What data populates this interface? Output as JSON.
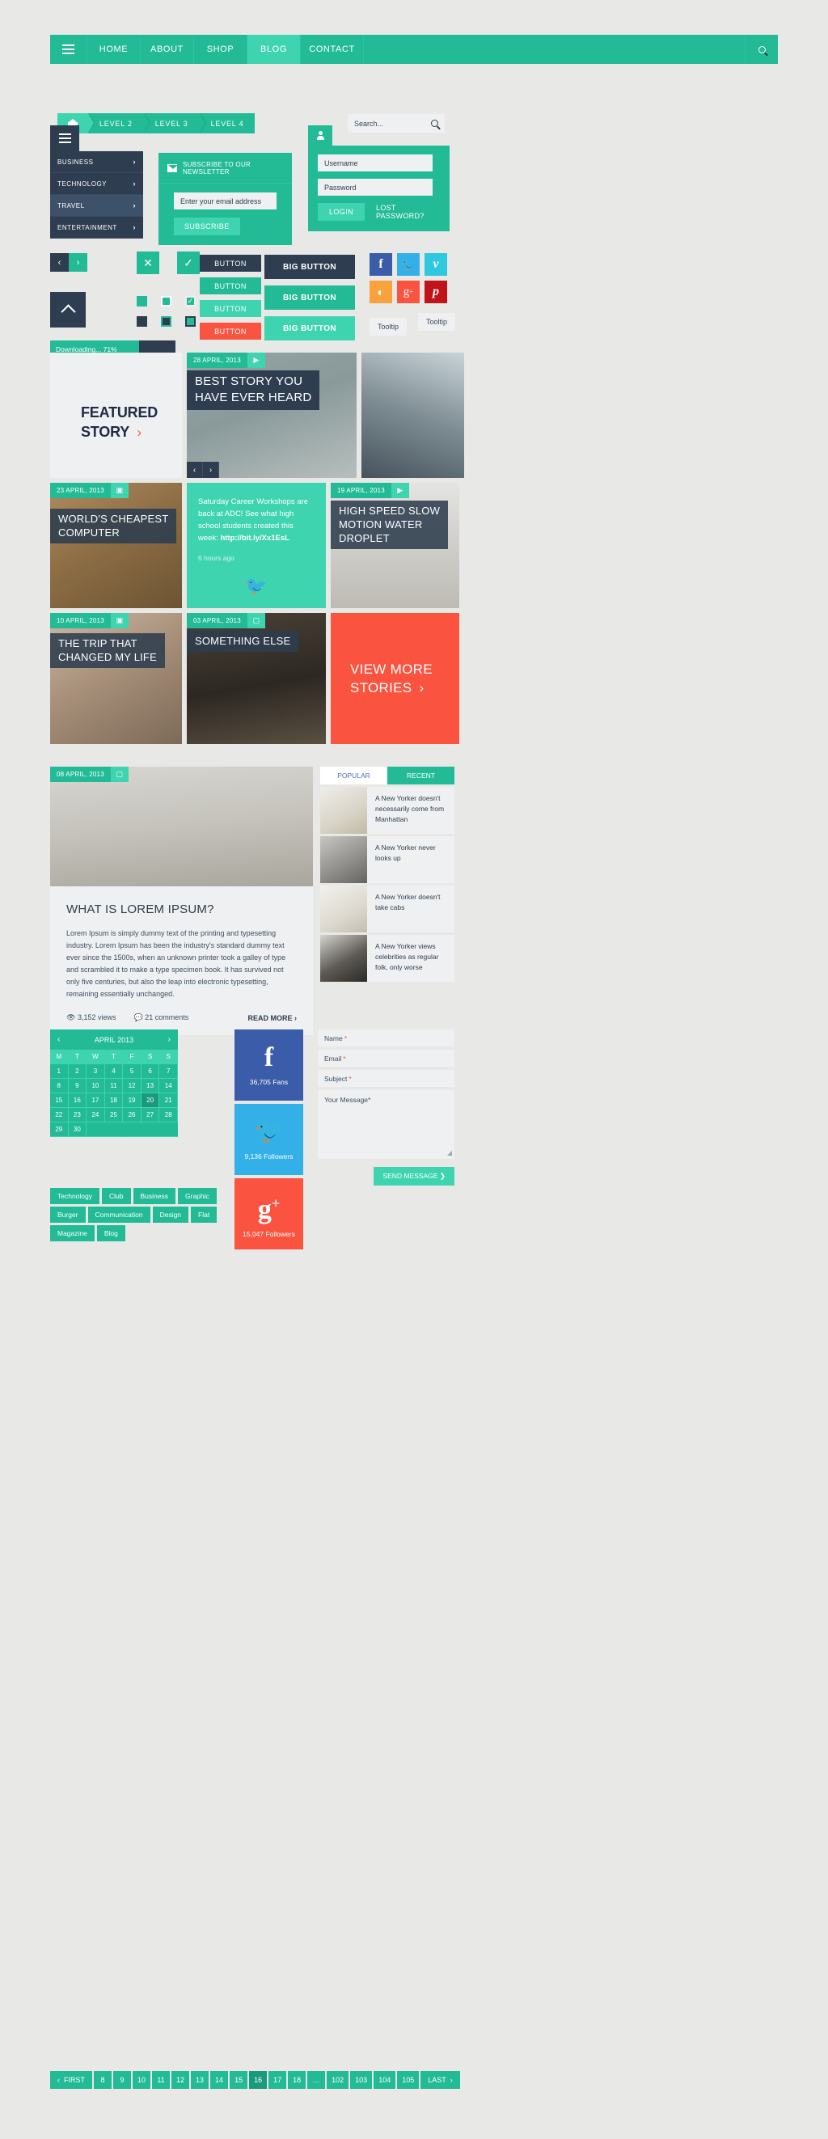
{
  "topnav": {
    "burger_icon": "hamburger-icon",
    "items": [
      {
        "label": "HOME",
        "active": false
      },
      {
        "label": "ABOUT",
        "active": false
      },
      {
        "label": "SHOP",
        "active": false
      },
      {
        "label": "BLOG",
        "active": true
      },
      {
        "label": "CONTACT",
        "active": false
      }
    ],
    "search_icon": "search-icon"
  },
  "breadcrumb": {
    "home_icon": "home-icon",
    "items": [
      "LEVEL 2",
      "LEVEL 3",
      "LEVEL 4"
    ]
  },
  "sidebar": {
    "toggle_icon": "hamburger-icon",
    "items": [
      {
        "label": "BUSINESS",
        "chevron": "›"
      },
      {
        "label": "TECHNOLOGY",
        "chevron": "›"
      },
      {
        "label": "TRAVEL",
        "chevron": "›",
        "highlight": true
      },
      {
        "label": "ENTERTAINMENT",
        "chevron": "›"
      }
    ]
  },
  "newsletter": {
    "icon": "envelope-icon",
    "title": "SUBSCRIBE TO OUR NEWSLETTER",
    "placeholder": "Enter your email address",
    "value": "Enter your email address",
    "button": "SUBSCRIBE"
  },
  "search": {
    "placeholder": "Search...",
    "value": "Search...",
    "icon": "magnifier-icon"
  },
  "login": {
    "tab_icon": "user-icon",
    "username_placeholder": "Username",
    "username_value": "Username",
    "password_placeholder": "Password",
    "password_value": "Password",
    "button": "LOGIN",
    "lost_link": "LOST PASSWORD?"
  },
  "widgets": {
    "prev_icon": "chevron-left-icon",
    "next_icon": "chevron-right-icon",
    "close_icon": "close-icon",
    "check_icon": "check-icon",
    "up_icon": "chevron-up-icon",
    "progress_label": "Downloading... 71%",
    "progress_percent": 71,
    "buttons": [
      {
        "label": "BUTTON",
        "color": "#2e3d4f"
      },
      {
        "label": "BUTTON",
        "color": "#22bb96"
      },
      {
        "label": "BUTTON",
        "color": "#3fd4b0"
      },
      {
        "label": "BUTTON",
        "color": "#fa5441"
      }
    ],
    "big_buttons": [
      {
        "label": "BIG BUTTON",
        "color": "#2e3d4f"
      },
      {
        "label": "BIG BUTTON",
        "color": "#22bb96"
      },
      {
        "label": "BIG BUTTON",
        "color": "#3fd4b0"
      }
    ],
    "social": [
      {
        "name": "facebook-icon",
        "glyph": "f",
        "color": "#3b5ca8"
      },
      {
        "name": "twitter-icon",
        "glyph": "ᵗ",
        "color": "#33b0e8"
      },
      {
        "name": "vimeo-icon",
        "glyph": "v",
        "color": "#2fc8e0"
      },
      {
        "name": "rss-icon",
        "glyph": "◔",
        "color": "#f9a13a"
      },
      {
        "name": "googleplus-icon",
        "glyph": "g+",
        "color": "#fa5441"
      },
      {
        "name": "pinterest-icon",
        "glyph": "p",
        "color": "#c2121a"
      }
    ],
    "tooltip_a": "Tooltip",
    "tooltip_b": "Tooltip"
  },
  "featured": {
    "line1": "FEATURED",
    "line2": "STORY",
    "arrow": "›"
  },
  "cards": [
    {
      "id": "best-story",
      "date": "28 APRIL, 2013",
      "icon": "video-icon",
      "title": "BEST STORY YOU\nHAVE EVER HEARD",
      "prev": "‹",
      "next": "›"
    },
    {
      "id": "cheapest-computer",
      "date": "23 APRIL, 2013",
      "icon": "camera-icon",
      "title": "WORLD'S CHEAPEST\nCOMPUTER"
    },
    {
      "id": "tweet",
      "text": "Saturday Career Workshops are back at ADC! See what high school students created this week: ",
      "link": "http://bit.ly/Xx1EsL",
      "ago": "6 hours ago",
      "icon": "twitter-bird-icon"
    },
    {
      "id": "water-droplet",
      "date": "19 APRIL, 2013",
      "icon": "video-icon",
      "title": "HIGH SPEED SLOW\nMOTION WATER\nDROPLET"
    },
    {
      "id": "trip-changed-life",
      "date": "10 APRIL, 2013",
      "icon": "camera-icon",
      "title": "THE TRIP THAT\nCHANGED MY LIFE"
    },
    {
      "id": "something-else",
      "date": "03 APRIL, 2013",
      "icon": "doc-icon",
      "title": "SOMETHING ELSE"
    },
    {
      "id": "view-more",
      "line1": "VIEW MORE",
      "line2": "STORIES",
      "arrow": "›"
    }
  ],
  "article": {
    "date": "08 APRIL, 2013",
    "icon": "doc-icon",
    "title": "WHAT IS LOREM IPSUM?",
    "body": "Lorem Ipsum is simply dummy text of the printing and typesetting industry. Lorem Ipsum has been the industry's standard dummy text ever since the 1500s, when an unknown printer took a galley of type and scrambled it to make a type specimen book. It has survived not only five centuries, but also the leap into electronic typesetting, remaining essentially unchanged.",
    "views_icon": "eye-icon",
    "views": "3,152 views",
    "comments_icon": "comment-icon",
    "comments": "21 comments",
    "read_more": "READ MORE",
    "read_more_arrow": "›"
  },
  "popular": {
    "tabs": [
      {
        "label": "POPULAR",
        "active": false
      },
      {
        "label": "RECENT",
        "active": true
      }
    ],
    "items": [
      {
        "text": "A New Yorker doesn't necessarily come from Manhattan"
      },
      {
        "text": "A New Yorker never looks up"
      },
      {
        "text": "A New Yorker doesn't take cabs"
      },
      {
        "text": "A New Yorker views celebrities as regular folk, only worse"
      }
    ]
  },
  "calendar": {
    "prev_icon": "chevron-left-icon",
    "next_icon": "chevron-right-icon",
    "month": "APRIL 2013",
    "dow": [
      "M",
      "T",
      "W",
      "T",
      "F",
      "S",
      "S"
    ],
    "days": [
      1,
      2,
      3,
      4,
      5,
      6,
      7,
      8,
      9,
      10,
      11,
      12,
      13,
      14,
      15,
      16,
      17,
      18,
      19,
      20,
      21,
      22,
      23,
      24,
      25,
      26,
      27,
      28,
      29,
      30
    ],
    "selected": 20
  },
  "tags": [
    "Technology",
    "Club",
    "Business",
    "Graphic",
    "Burger",
    "Communication",
    "Design",
    "Flat",
    "Magazine",
    "Blog"
  ],
  "counters": [
    {
      "name": "facebook-counter",
      "glyph": "f",
      "count": "36,705 Fans",
      "color": "#3b5ca8"
    },
    {
      "name": "twitter-counter",
      "glyph": "ᵗ",
      "count": "9,136 Followers",
      "color": "#33b0e8"
    },
    {
      "name": "googleplus-counter",
      "glyph": "g+",
      "count": "15,047 Followers",
      "color": "#fa5441"
    }
  ],
  "contact": {
    "name_label": "Name",
    "email_label": "Email",
    "subject_label": "Subject",
    "message_label": "Your Message",
    "required_mark": "*",
    "send_label": "SEND MESSAGE",
    "send_arrow": "❯"
  },
  "pagination": {
    "first": "FIRST",
    "first_arrow": "‹",
    "last": "LAST",
    "last_arrow": "›",
    "pages": [
      "8",
      "9",
      "10",
      "11",
      "12",
      "13",
      "14",
      "15",
      "16",
      "17",
      "18",
      "…",
      "102",
      "103",
      "104",
      "105"
    ],
    "current": "16"
  }
}
